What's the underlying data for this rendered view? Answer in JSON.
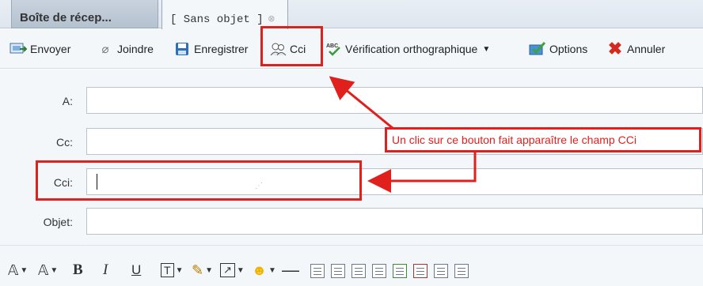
{
  "tabs": [
    {
      "label": "Boîte de récep...",
      "active": false
    },
    {
      "label": "[ Sans objet ]",
      "active": true,
      "close_icon": "close-icon"
    }
  ],
  "toolbar": {
    "send_label": "Envoyer",
    "attach_label": "Joindre",
    "save_label": "Enregistrer",
    "bcc_label": "Cci",
    "spellcheck_label": "Vérification orthographique",
    "options_label": "Options",
    "cancel_label": "Annuler"
  },
  "form": {
    "to_label": "A:",
    "cc_label": "Cc:",
    "bcc_label": "Cci:",
    "subject_label": "Objet:"
  },
  "annotation": {
    "callout_text": "Un clic sur ce bouton fait apparaître le champ CCi",
    "color": "#e0201c"
  },
  "format_bar": {
    "bold": "B",
    "italic": "I",
    "underline": "U"
  }
}
